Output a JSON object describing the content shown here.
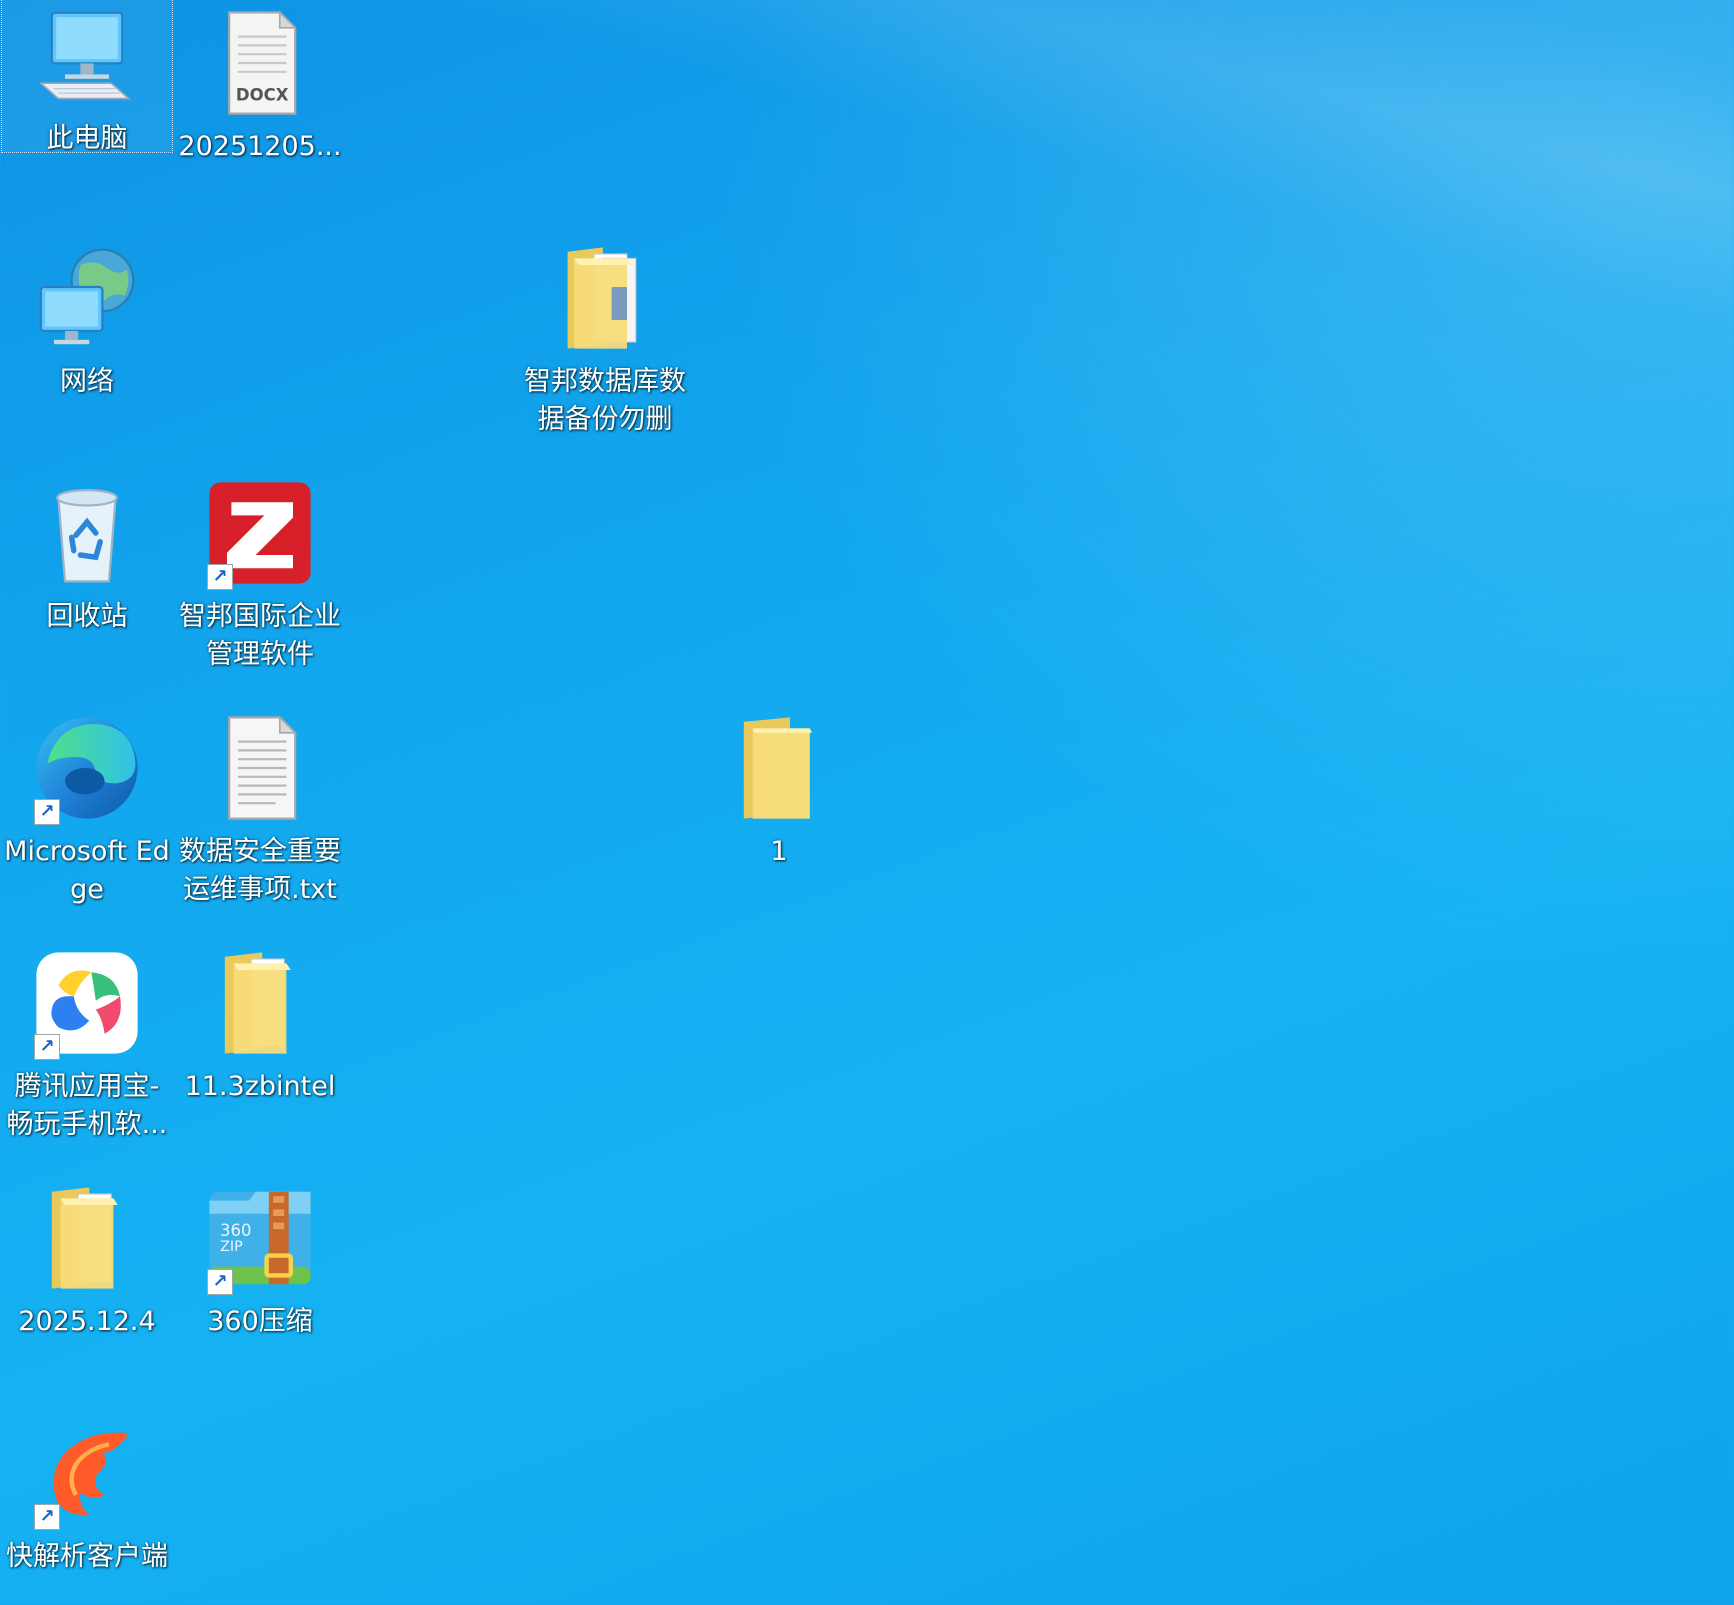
{
  "desktop": {
    "icons": [
      {
        "id": "this-pc",
        "label": "此电脑",
        "type": "computer",
        "selected": true
      },
      {
        "id": "docx-file",
        "label": "20251205...",
        "type": "docx"
      },
      {
        "id": "network",
        "label": "网络",
        "type": "network"
      },
      {
        "id": "zhibang-backup-folder",
        "label": "智邦数据库数据备份勿删",
        "type": "folder"
      },
      {
        "id": "recycle-bin",
        "label": "回收站",
        "type": "recycle"
      },
      {
        "id": "zhibang-software",
        "label": "智邦国际企业管理软件",
        "type": "app-z",
        "shortcut": true
      },
      {
        "id": "microsoft-edge",
        "label": "Microsoft Edge",
        "type": "edge",
        "shortcut": true
      },
      {
        "id": "txt-file",
        "label": "数据安全重要运维事项.txt",
        "type": "txt"
      },
      {
        "id": "folder-1",
        "label": "1",
        "type": "folder"
      },
      {
        "id": "tencent-app-store",
        "label": "腾讯应用宝-畅玩手机软...",
        "type": "tencent",
        "shortcut": true
      },
      {
        "id": "folder-zbintel",
        "label": "11.3zbintel",
        "type": "folder"
      },
      {
        "id": "folder-2025-12-4",
        "label": "2025.12.4",
        "type": "folder"
      },
      {
        "id": "360zip",
        "label": "360压缩",
        "type": "zip360",
        "shortcut": true
      },
      {
        "id": "kuaijiexi-client",
        "label": "快解析客户端",
        "type": "kuaijiexi",
        "shortcut": true
      }
    ],
    "shortcut_arrow": "↗",
    "docx_badge": "DOCX",
    "zip_badge_top": "360",
    "zip_badge_bottom": "ZIP"
  }
}
